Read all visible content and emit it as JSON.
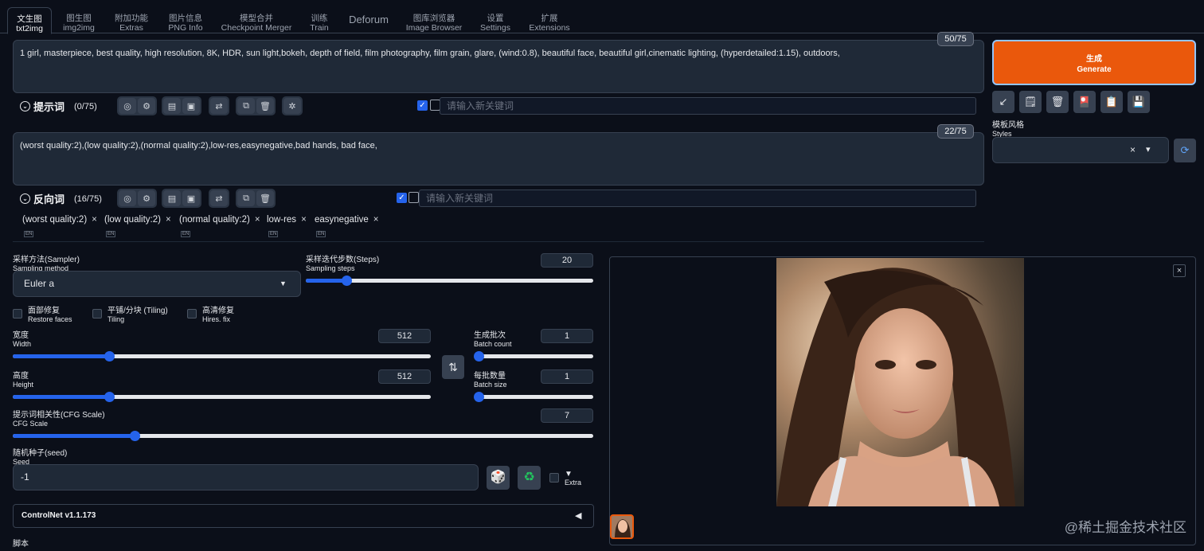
{
  "tabs": [
    {
      "cn": "文生图",
      "en": "txt2img",
      "active": true
    },
    {
      "cn": "图生图",
      "en": "img2img"
    },
    {
      "cn": "附加功能",
      "en": "Extras"
    },
    {
      "cn": "图片信息",
      "en": "PNG Info"
    },
    {
      "cn": "模型合并",
      "en": "Checkpoint Merger"
    },
    {
      "cn": "训练",
      "en": "Train"
    },
    {
      "cn": "Deforum",
      "en": ""
    },
    {
      "cn": "图库浏览器",
      "en": "Image Browser"
    },
    {
      "cn": "设置",
      "en": "Settings"
    },
    {
      "cn": "扩展",
      "en": "Extensions"
    }
  ],
  "prompt": {
    "text": "1 girl, masterpiece, best quality, high resolution, 8K, HDR, sun light,bokeh, depth of field, film photography, film grain, glare, (wind:0.8), beautiful face, beautiful girl,cinematic lighting, (hyperdetailed:1.15), outdoors,",
    "counter": "50/75",
    "title": "提示词",
    "count": "(0/75)",
    "keyword_placeholder": "请输入新关键词"
  },
  "negative": {
    "text": "(worst quality:2),(low quality:2),(normal quality:2),low-res,easynegative,bad hands, bad face,",
    "counter": "22/75",
    "title": "反向词",
    "count": "(16/75)",
    "keyword_placeholder": "请输入新关键词",
    "tags": [
      "(worst quality:2)",
      "(low quality:2)",
      "(normal quality:2)",
      "low-res",
      "easynegative"
    ]
  },
  "generate": {
    "cn": "生成",
    "en": "Generate"
  },
  "styles": {
    "cn": "模板风格",
    "en": "Styles",
    "clear": "×",
    "arrow": "▾"
  },
  "sampler": {
    "cn": "采样方法(Sampler)",
    "en": "Sampling method",
    "value": "Euler a"
  },
  "steps": {
    "cn": "采样迭代步数(Steps)",
    "en": "Sampling steps",
    "value": "20",
    "fraction": 0.14
  },
  "options": [
    {
      "cn": "面部修复",
      "en": "Restore faces"
    },
    {
      "cn": "平铺/分块 (Tiling)",
      "en": "Tiling"
    },
    {
      "cn": "高清修复",
      "en": "Hires. fix"
    }
  ],
  "width": {
    "cn": "宽度",
    "en": "Width",
    "value": "512",
    "fraction": 0.23
  },
  "height": {
    "cn": "高度",
    "en": "Height",
    "value": "512",
    "fraction": 0.23
  },
  "batch_count": {
    "cn": "生成批次",
    "en": "Batch count",
    "value": "1",
    "fraction": 0.0
  },
  "batch_size": {
    "cn": "每批数量",
    "en": "Batch size",
    "value": "1",
    "fraction": 0.0
  },
  "cfg": {
    "cn": "提示词相关性(CFG Scale)",
    "en": "CFG Scale",
    "value": "7",
    "fraction": 0.21
  },
  "seed": {
    "cn": "随机种子(seed)",
    "en": "Seed",
    "value": "-1",
    "extra_label": "Extra",
    "extra_arrow": "▼"
  },
  "controlnet": {
    "label": "ControlNet v1.1.173",
    "arrow": "◀"
  },
  "script": {
    "cn": "脚本"
  },
  "close_symbol": "×",
  "watermark": "@稀土掘金技术社区"
}
